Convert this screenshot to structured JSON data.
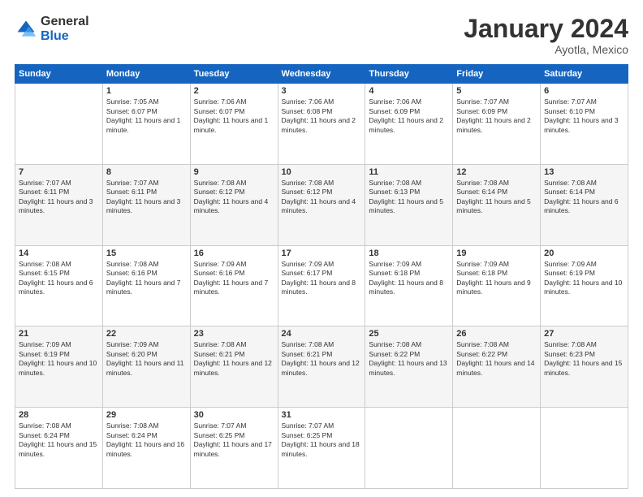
{
  "logo": {
    "general": "General",
    "blue": "Blue"
  },
  "title": "January 2024",
  "subtitle": "Ayotla, Mexico",
  "headers": [
    "Sunday",
    "Monday",
    "Tuesday",
    "Wednesday",
    "Thursday",
    "Friday",
    "Saturday"
  ],
  "weeks": [
    [
      {
        "day": "",
        "sunrise": "",
        "sunset": "",
        "daylight": ""
      },
      {
        "day": "1",
        "sunrise": "Sunrise: 7:05 AM",
        "sunset": "Sunset: 6:07 PM",
        "daylight": "Daylight: 11 hours and 1 minute."
      },
      {
        "day": "2",
        "sunrise": "Sunrise: 7:06 AM",
        "sunset": "Sunset: 6:07 PM",
        "daylight": "Daylight: 11 hours and 1 minute."
      },
      {
        "day": "3",
        "sunrise": "Sunrise: 7:06 AM",
        "sunset": "Sunset: 6:08 PM",
        "daylight": "Daylight: 11 hours and 2 minutes."
      },
      {
        "day": "4",
        "sunrise": "Sunrise: 7:06 AM",
        "sunset": "Sunset: 6:09 PM",
        "daylight": "Daylight: 11 hours and 2 minutes."
      },
      {
        "day": "5",
        "sunrise": "Sunrise: 7:07 AM",
        "sunset": "Sunset: 6:09 PM",
        "daylight": "Daylight: 11 hours and 2 minutes."
      },
      {
        "day": "6",
        "sunrise": "Sunrise: 7:07 AM",
        "sunset": "Sunset: 6:10 PM",
        "daylight": "Daylight: 11 hours and 3 minutes."
      }
    ],
    [
      {
        "day": "7",
        "sunrise": "Sunrise: 7:07 AM",
        "sunset": "Sunset: 6:11 PM",
        "daylight": "Daylight: 11 hours and 3 minutes."
      },
      {
        "day": "8",
        "sunrise": "Sunrise: 7:07 AM",
        "sunset": "Sunset: 6:11 PM",
        "daylight": "Daylight: 11 hours and 3 minutes."
      },
      {
        "day": "9",
        "sunrise": "Sunrise: 7:08 AM",
        "sunset": "Sunset: 6:12 PM",
        "daylight": "Daylight: 11 hours and 4 minutes."
      },
      {
        "day": "10",
        "sunrise": "Sunrise: 7:08 AM",
        "sunset": "Sunset: 6:12 PM",
        "daylight": "Daylight: 11 hours and 4 minutes."
      },
      {
        "day": "11",
        "sunrise": "Sunrise: 7:08 AM",
        "sunset": "Sunset: 6:13 PM",
        "daylight": "Daylight: 11 hours and 5 minutes."
      },
      {
        "day": "12",
        "sunrise": "Sunrise: 7:08 AM",
        "sunset": "Sunset: 6:14 PM",
        "daylight": "Daylight: 11 hours and 5 minutes."
      },
      {
        "day": "13",
        "sunrise": "Sunrise: 7:08 AM",
        "sunset": "Sunset: 6:14 PM",
        "daylight": "Daylight: 11 hours and 6 minutes."
      }
    ],
    [
      {
        "day": "14",
        "sunrise": "Sunrise: 7:08 AM",
        "sunset": "Sunset: 6:15 PM",
        "daylight": "Daylight: 11 hours and 6 minutes."
      },
      {
        "day": "15",
        "sunrise": "Sunrise: 7:08 AM",
        "sunset": "Sunset: 6:16 PM",
        "daylight": "Daylight: 11 hours and 7 minutes."
      },
      {
        "day": "16",
        "sunrise": "Sunrise: 7:09 AM",
        "sunset": "Sunset: 6:16 PM",
        "daylight": "Daylight: 11 hours and 7 minutes."
      },
      {
        "day": "17",
        "sunrise": "Sunrise: 7:09 AM",
        "sunset": "Sunset: 6:17 PM",
        "daylight": "Daylight: 11 hours and 8 minutes."
      },
      {
        "day": "18",
        "sunrise": "Sunrise: 7:09 AM",
        "sunset": "Sunset: 6:18 PM",
        "daylight": "Daylight: 11 hours and 8 minutes."
      },
      {
        "day": "19",
        "sunrise": "Sunrise: 7:09 AM",
        "sunset": "Sunset: 6:18 PM",
        "daylight": "Daylight: 11 hours and 9 minutes."
      },
      {
        "day": "20",
        "sunrise": "Sunrise: 7:09 AM",
        "sunset": "Sunset: 6:19 PM",
        "daylight": "Daylight: 11 hours and 10 minutes."
      }
    ],
    [
      {
        "day": "21",
        "sunrise": "Sunrise: 7:09 AM",
        "sunset": "Sunset: 6:19 PM",
        "daylight": "Daylight: 11 hours and 10 minutes."
      },
      {
        "day": "22",
        "sunrise": "Sunrise: 7:09 AM",
        "sunset": "Sunset: 6:20 PM",
        "daylight": "Daylight: 11 hours and 11 minutes."
      },
      {
        "day": "23",
        "sunrise": "Sunrise: 7:08 AM",
        "sunset": "Sunset: 6:21 PM",
        "daylight": "Daylight: 11 hours and 12 minutes."
      },
      {
        "day": "24",
        "sunrise": "Sunrise: 7:08 AM",
        "sunset": "Sunset: 6:21 PM",
        "daylight": "Daylight: 11 hours and 12 minutes."
      },
      {
        "day": "25",
        "sunrise": "Sunrise: 7:08 AM",
        "sunset": "Sunset: 6:22 PM",
        "daylight": "Daylight: 11 hours and 13 minutes."
      },
      {
        "day": "26",
        "sunrise": "Sunrise: 7:08 AM",
        "sunset": "Sunset: 6:22 PM",
        "daylight": "Daylight: 11 hours and 14 minutes."
      },
      {
        "day": "27",
        "sunrise": "Sunrise: 7:08 AM",
        "sunset": "Sunset: 6:23 PM",
        "daylight": "Daylight: 11 hours and 15 minutes."
      }
    ],
    [
      {
        "day": "28",
        "sunrise": "Sunrise: 7:08 AM",
        "sunset": "Sunset: 6:24 PM",
        "daylight": "Daylight: 11 hours and 15 minutes."
      },
      {
        "day": "29",
        "sunrise": "Sunrise: 7:08 AM",
        "sunset": "Sunset: 6:24 PM",
        "daylight": "Daylight: 11 hours and 16 minutes."
      },
      {
        "day": "30",
        "sunrise": "Sunrise: 7:07 AM",
        "sunset": "Sunset: 6:25 PM",
        "daylight": "Daylight: 11 hours and 17 minutes."
      },
      {
        "day": "31",
        "sunrise": "Sunrise: 7:07 AM",
        "sunset": "Sunset: 6:25 PM",
        "daylight": "Daylight: 11 hours and 18 minutes."
      },
      {
        "day": "",
        "sunrise": "",
        "sunset": "",
        "daylight": ""
      },
      {
        "day": "",
        "sunrise": "",
        "sunset": "",
        "daylight": ""
      },
      {
        "day": "",
        "sunrise": "",
        "sunset": "",
        "daylight": ""
      }
    ]
  ]
}
